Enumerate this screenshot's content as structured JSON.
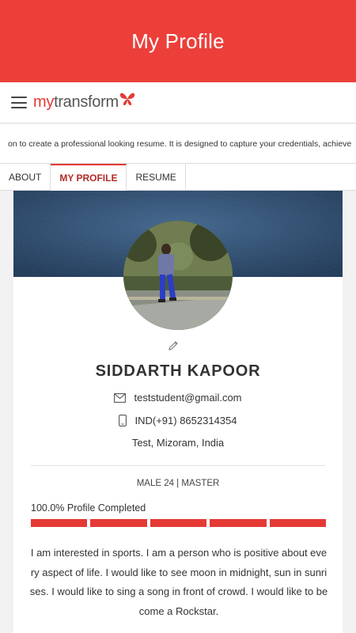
{
  "header": {
    "title": "My Profile"
  },
  "brand": {
    "prefix": "my",
    "suffix": "transform"
  },
  "marquee": {
    "text": "on to create a professional looking resume. It is designed to capture your credentials, achieve"
  },
  "tabs": [
    {
      "label": "ABOUT",
      "active": false
    },
    {
      "label": "MY PROFILE",
      "active": true
    },
    {
      "label": "RESUME",
      "active": false
    }
  ],
  "profile": {
    "name": "SIDDARTH KAPOOR",
    "email": "teststudent@gmail.com",
    "phone": "IND(+91) 8652314354",
    "location": "Test, Mizoram, India",
    "meta": "MALE 24 | MASTER",
    "progress_label": "100.0% Profile Completed",
    "progress": 1.0,
    "progress_segments": 5,
    "bio": "I am interested in sports. I am a person who is positive about every aspect of life. I would like to see moon in midnight, sun in sunrises. I would like to sing a song in front of crowd. I would like to become a Rockstar."
  },
  "colors": {
    "accent": "#ec3f3a",
    "progress": "#e53935",
    "active_tab": "#b22b27"
  },
  "icons": [
    "hamburger-menu-icon",
    "butterfly-logo-icon",
    "pencil-edit-icon",
    "envelope-icon",
    "mobile-phone-icon"
  ]
}
